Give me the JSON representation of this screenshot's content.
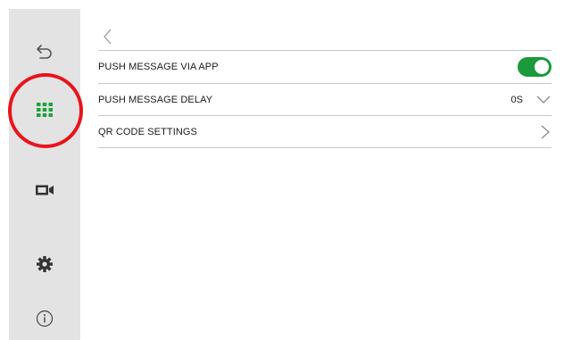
{
  "colors": {
    "sidebar_bg": "#e3e3e3",
    "accent_green": "#1ea33c",
    "toggle_on": "#1a9a3a",
    "highlight_red": "#e8141b",
    "icon_gray": "#555555"
  },
  "sidebar": {
    "items": [
      {
        "icon": "back-arrow-icon"
      },
      {
        "icon": "apps-grid-icon",
        "active": true
      },
      {
        "icon": "video-camera-icon"
      },
      {
        "icon": "gear-icon"
      },
      {
        "icon": "info-icon"
      }
    ]
  },
  "settings": {
    "rows": [
      {
        "label": "PUSH MESSAGE VIA APP",
        "control": "toggle",
        "on": true
      },
      {
        "label": "PUSH MESSAGE DELAY",
        "value": "0S",
        "control": "dropdown"
      },
      {
        "label": "QR CODE SETTINGS",
        "control": "chevron-right"
      }
    ]
  }
}
